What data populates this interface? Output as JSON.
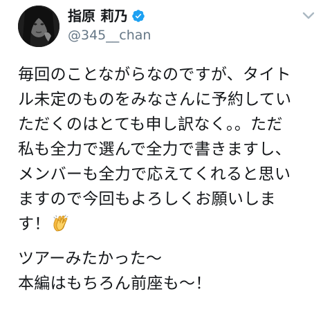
{
  "user": {
    "display_name": "指原 莉乃",
    "handle": "@345__chan",
    "verified": true,
    "avatar_icon": "profile-photo"
  },
  "header": {
    "menu_icon": "chevron-down-icon"
  },
  "tweet": {
    "paragraph1": [
      "毎回のことながらなのですが、タイト",
      "ル未定のものをみなさんに予約してい",
      "ただくのはとても申し訳なく。。ただ",
      "私も全力で選んで全力で書きますし、",
      "メンバーも全力で応えてくれると思い",
      "ますので今回もよろしくお願いしま",
      "す！"
    ],
    "emoji_after_paragraph1": "clapping-hands-icon",
    "paragraph2": [
      "ツアーみたかった〜",
      "本編はもちろん前座も〜！"
    ]
  },
  "colors": {
    "text": "#14171a",
    "handle": "#657786",
    "verified": "#1da1f2",
    "chevron": "#aab8c2",
    "clap": "#f5b841"
  }
}
